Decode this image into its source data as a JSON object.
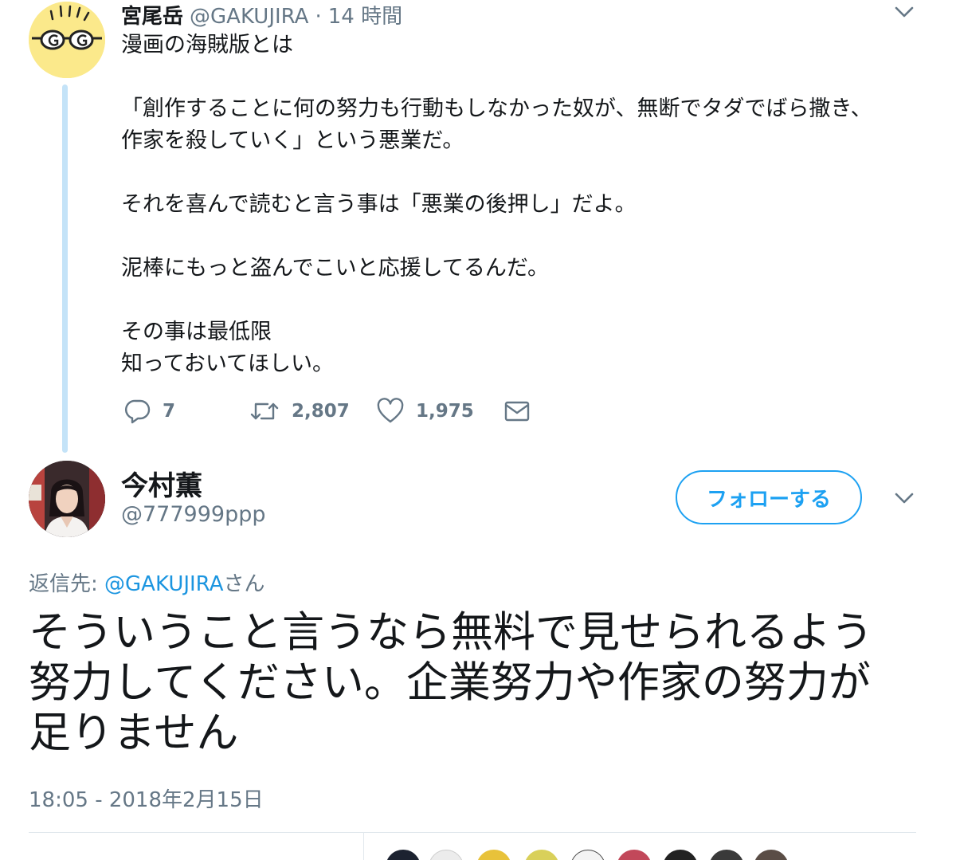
{
  "parent": {
    "name": "宮尾岳",
    "handle": "@GAKUJIRA",
    "separator": "·",
    "time": "14 時間",
    "lines": [
      "漫画の海賊版とは",
      "",
      "「創作することに何の努力も行動もしなかった奴が、無断でタダでばら撒き、",
      "作家を殺していく」という悪業だ。",
      "",
      "それを喜んで読むと言う事は「悪業の後押し」だよ。",
      "",
      "泥棒にもっと盗んでこいと応援してるんだ。",
      "",
      "その事は最低限",
      "知っておいてほしい。"
    ],
    "actions": {
      "reply_count": "7",
      "retweet_count": "2,807",
      "like_count": "1,975"
    }
  },
  "main": {
    "name": "今村薫",
    "handle": "@777999ppp",
    "follow_label": "フォローする",
    "reply_prefix": "返信先: ",
    "reply_mention": "@GAKUJIRA",
    "reply_suffix": "さん",
    "lines": [
      "そういうこと言うなら無料で見せられるよう",
      "努力してください。企業努力や作家の努力が",
      "足りません"
    ],
    "timestamp": "18:05 - 2018年2月15日"
  },
  "colors": {
    "accent": "#1da1f2",
    "muted": "#657786",
    "thread_line": "#c4e3f8"
  },
  "icons": {
    "reply": "reply-icon",
    "retweet": "retweet-icon",
    "like": "heart-icon",
    "dm": "mail-icon",
    "menu": "chevron-down-icon"
  }
}
